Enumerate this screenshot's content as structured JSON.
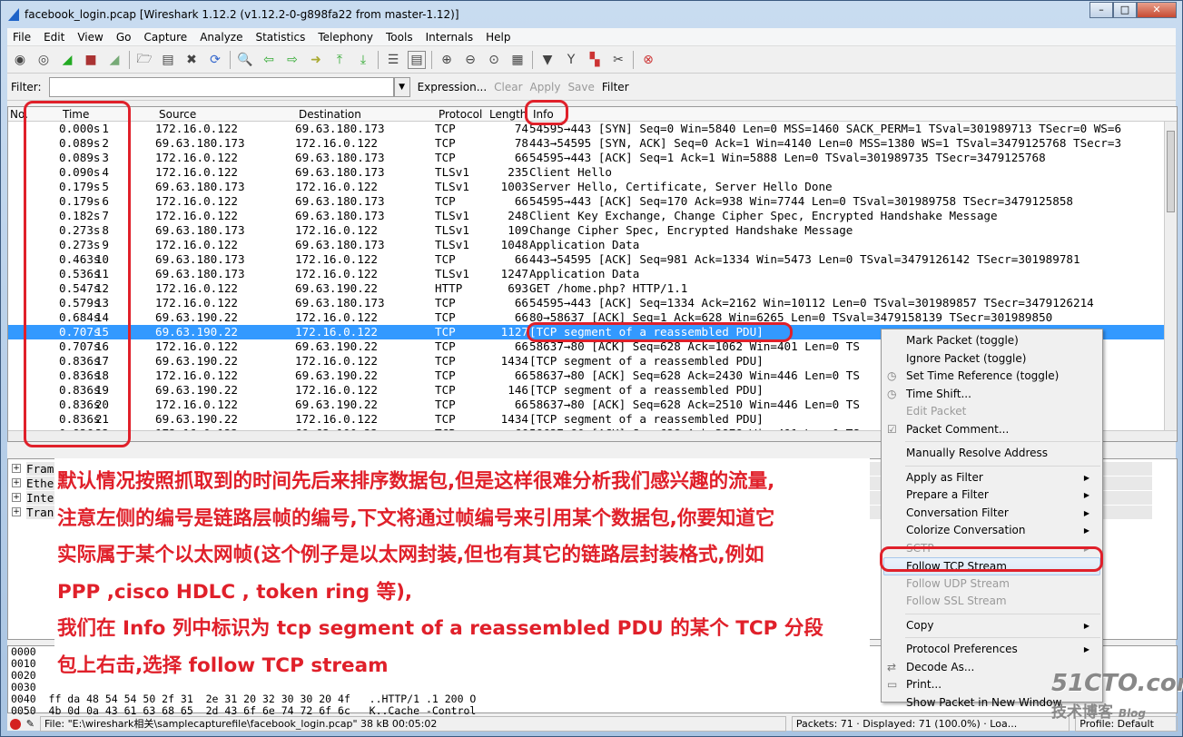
{
  "window": {
    "title": "facebook_login.pcap   [Wireshark 1.12.2  (v1.12.2-0-g898fa22 from master-1.12)]"
  },
  "menu": [
    "File",
    "Edit",
    "View",
    "Go",
    "Capture",
    "Analyze",
    "Statistics",
    "Telephony",
    "Tools",
    "Internals",
    "Help"
  ],
  "filter": {
    "label": "Filter:",
    "value": "",
    "expression": "Expression...",
    "clear": "Clear",
    "apply": "Apply",
    "save": "Save",
    "filter_btn": "Filter"
  },
  "columns": {
    "no": "No.",
    "time": "Time",
    "source": "Source",
    "destination": "Destination",
    "protocol": "Protocol",
    "length": "Length",
    "info": "Info"
  },
  "packets": [
    [
      "1",
      "0.000s",
      "172.16.0.122",
      "69.63.180.173",
      "TCP",
      "74",
      "54595→443 [SYN] Seq=0 Win=5840 Len=0 MSS=1460 SACK_PERM=1 TSval=301989713 TSecr=0 WS=6"
    ],
    [
      "2",
      "0.089s",
      "69.63.180.173",
      "172.16.0.122",
      "TCP",
      "78",
      "443→54595 [SYN, ACK] Seq=0 Ack=1 Win=4140 Len=0 MSS=1380 WS=1 TSval=3479125768 TSecr=3"
    ],
    [
      "3",
      "0.089s",
      "172.16.0.122",
      "69.63.180.173",
      "TCP",
      "66",
      "54595→443 [ACK] Seq=1 Ack=1 Win=5888 Len=0 TSval=301989735 TSecr=3479125768"
    ],
    [
      "4",
      "0.090s",
      "172.16.0.122",
      "69.63.180.173",
      "TLSv1",
      "235",
      "Client Hello"
    ],
    [
      "5",
      "0.179s",
      "69.63.180.173",
      "172.16.0.122",
      "TLSv1",
      "1003",
      "Server Hello, Certificate, Server Hello Done"
    ],
    [
      "6",
      "0.179s",
      "172.16.0.122",
      "69.63.180.173",
      "TCP",
      "66",
      "54595→443 [ACK] Seq=170 Ack=938 Win=7744 Len=0 TSval=301989758 TSecr=3479125858"
    ],
    [
      "7",
      "0.182s",
      "172.16.0.122",
      "69.63.180.173",
      "TLSv1",
      "248",
      "Client Key Exchange, Change Cipher Spec, Encrypted Handshake Message"
    ],
    [
      "8",
      "0.273s",
      "69.63.180.173",
      "172.16.0.122",
      "TLSv1",
      "109",
      "Change Cipher Spec, Encrypted Handshake Message"
    ],
    [
      "9",
      "0.273s",
      "172.16.0.122",
      "69.63.180.173",
      "TLSv1",
      "1048",
      "Application Data"
    ],
    [
      "10",
      "0.463s",
      "69.63.180.173",
      "172.16.0.122",
      "TCP",
      "66",
      "443→54595 [ACK] Seq=981 Ack=1334 Win=5473 Len=0 TSval=3479126142 TSecr=301989781"
    ],
    [
      "11",
      "0.536s",
      "69.63.180.173",
      "172.16.0.122",
      "TLSv1",
      "1247",
      "Application Data"
    ],
    [
      "12",
      "0.547s",
      "172.16.0.122",
      "69.63.190.22",
      "HTTP",
      "693",
      "GET /home.php? HTTP/1.1"
    ],
    [
      "13",
      "0.579s",
      "172.16.0.122",
      "69.63.180.173",
      "TCP",
      "66",
      "54595→443 [ACK] Seq=1334 Ack=2162 Win=10112 Len=0 TSval=301989857 TSecr=3479126214"
    ],
    [
      "14",
      "0.684s",
      "69.63.190.22",
      "172.16.0.122",
      "TCP",
      "66",
      "80→58637 [ACK] Seq=1 Ack=628 Win=6265 Len=0 TSval=3479158139 TSecr=301989850"
    ],
    [
      "15",
      "0.707s",
      "69.63.190.22",
      "172.16.0.122",
      "TCP",
      "1127",
      "[TCP segment of a reassembled PDU]"
    ],
    [
      "16",
      "0.707s",
      "172.16.0.122",
      "69.63.190.22",
      "TCP",
      "66",
      "58637→80 [ACK] Seq=628 Ack=1062 Win=401 Len=0 TS"
    ],
    [
      "17",
      "0.836s",
      "69.63.190.22",
      "172.16.0.122",
      "TCP",
      "1434",
      "[TCP segment of a reassembled PDU]"
    ],
    [
      "18",
      "0.836s",
      "172.16.0.122",
      "69.63.190.22",
      "TCP",
      "66",
      "58637→80 [ACK] Seq=628 Ack=2430 Win=446 Len=0 TS"
    ],
    [
      "19",
      "0.836s",
      "69.63.190.22",
      "172.16.0.122",
      "TCP",
      "146",
      "[TCP segment of a reassembled PDU]"
    ],
    [
      "20",
      "0.836s",
      "172.16.0.122",
      "69.63.190.22",
      "TCP",
      "66",
      "58637→80 [ACK] Seq=628 Ack=2510 Win=446 Len=0 TS"
    ],
    [
      "21",
      "0.836s",
      "69.63.190.22",
      "172.16.0.122",
      "TCP",
      "1434",
      "[TCP segment of a reassembled PDU]"
    ],
    [
      "22",
      "0.836s",
      "172.16.0.122",
      "69.63.190.22",
      "TCP",
      "66",
      "58637→80 [ACK] Seq=628 Ack=3878 Win=491 Len=0 TS"
    ]
  ],
  "selected_packet": "15",
  "details": [
    "Fram",
    "Ethe",
    "Inte",
    "Tran"
  ],
  "hex": [
    "0000",
    "0010",
    "0020",
    "0030",
    "0040  ff da 48 54 54 50 2f 31  2e 31 20 32 30 30 20 4f   ..HTTP/1 .1 200 O",
    "0050  4b 0d 0a 43 61 63 68 65  2d 43 6f 6e 74 72 6f 6c   K..Cache -Control"
  ],
  "annotation": [
    "默认情况按照抓取到的时间先后来排序数据包,但是这样很难分析我们感兴趣的流量,",
    "注意左侧的编号是链路层帧的编号,下文将通过帧编号来引用某个数据包,你要知道它",
    "实际属于某个以太网帧(这个例子是以太网封装,但也有其它的链路层封装格式,例如",
    "PPP ,cisco HDLC , token ring 等),",
    "我们在 Info 列中标识为 tcp segment of a reassembled PDU 的某个 TCP 分段",
    "包上右击,选择 follow TCP stream"
  ],
  "context_menu": [
    {
      "label": "Mark Packet (toggle)"
    },
    {
      "label": "Ignore Packet (toggle)"
    },
    {
      "label": "Set Time Reference (toggle)",
      "icon": "clock-icon"
    },
    {
      "label": "Time Shift...",
      "icon": "clock-icon"
    },
    {
      "label": "Edit Packet",
      "disabled": true
    },
    {
      "label": "Packet Comment...",
      "icon": "comment-icon"
    },
    {
      "sep": true
    },
    {
      "label": "Manually Resolve Address"
    },
    {
      "sep": true
    },
    {
      "label": "Apply as Filter",
      "submenu": true
    },
    {
      "label": "Prepare a Filter",
      "submenu": true
    },
    {
      "label": "Conversation Filter",
      "submenu": true
    },
    {
      "label": "Colorize Conversation",
      "submenu": true
    },
    {
      "label": "SCTP",
      "submenu": true,
      "disabled": true
    },
    {
      "label": "Follow TCP Stream",
      "highlighted": true
    },
    {
      "label": "Follow UDP Stream",
      "disabled": true
    },
    {
      "label": "Follow SSL Stream",
      "disabled": true
    },
    {
      "sep": true
    },
    {
      "label": "Copy",
      "submenu": true
    },
    {
      "sep": true
    },
    {
      "label": "Protocol Preferences",
      "submenu": true
    },
    {
      "label": "Decode As...",
      "icon": "decode-icon"
    },
    {
      "label": "Print...",
      "icon": "printer-icon"
    },
    {
      "label": "Show Packet in New Window"
    }
  ],
  "status": {
    "file": "File: \"E:\\wireshark相关\\samplecapturefile\\facebook_login.pcap\" 38 kB 00:05:02",
    "packets": "Packets: 71 · Displayed: 71 (100.0%) · Loa...",
    "profile": "Profile: Default"
  },
  "watermark": {
    "site": "51CTO.com",
    "sub": "技术博客",
    "blog": "Blog"
  },
  "colors": {
    "selection": "#3399ff",
    "annotation": "#e0202a"
  }
}
